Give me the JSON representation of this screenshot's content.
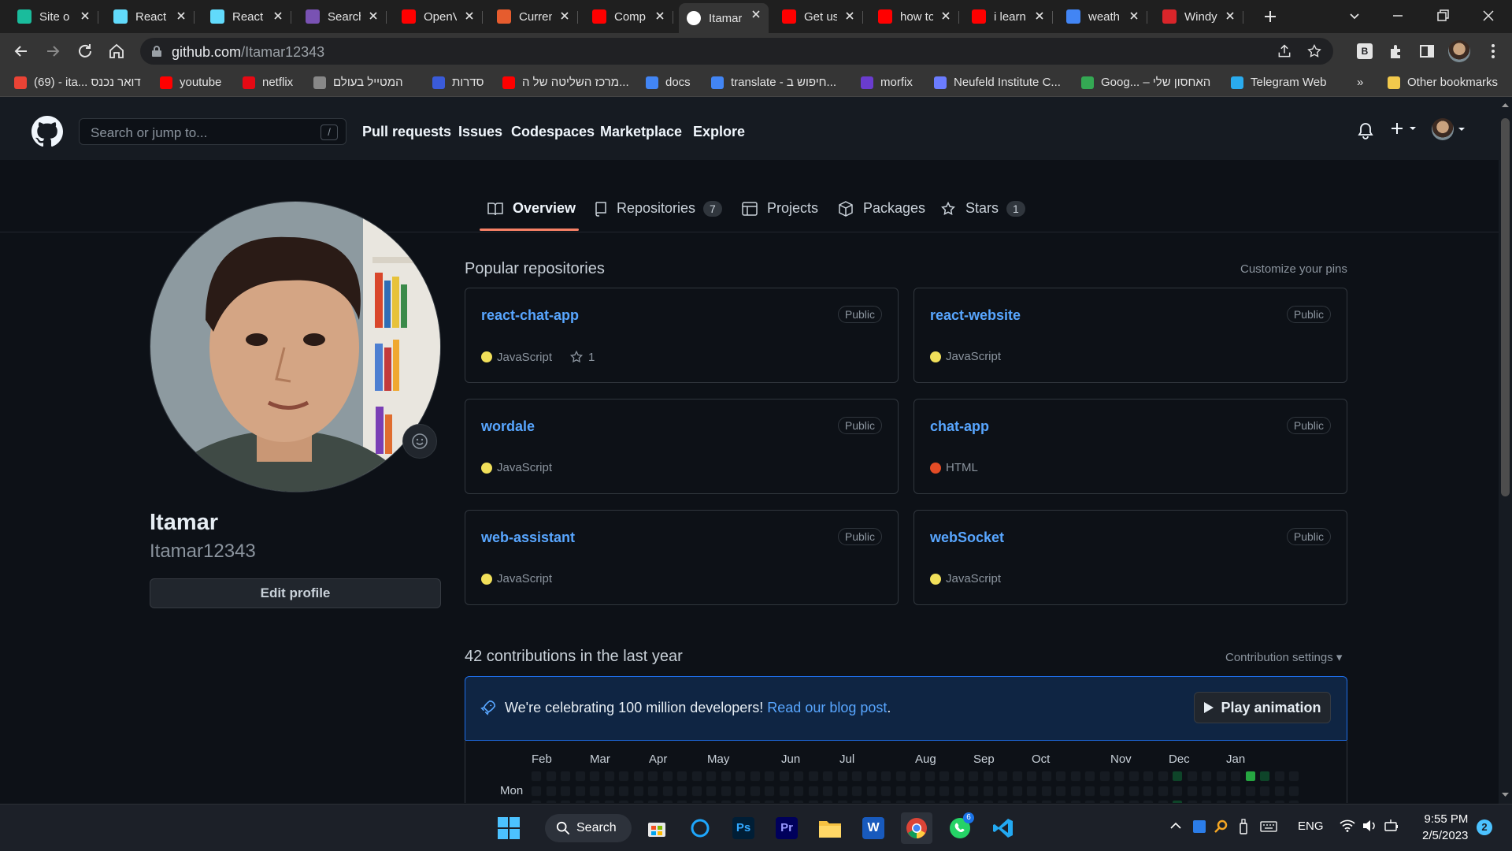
{
  "browser": {
    "tabs": [
      {
        "title": "Site o",
        "icon": "diamond-icon",
        "color": "#1abc9c"
      },
      {
        "title": "React",
        "icon": "react-icon",
        "color": "#61dafb"
      },
      {
        "title": "React",
        "icon": "react-icon",
        "color": "#61dafb"
      },
      {
        "title": "Search",
        "icon": "bootstrap-icon",
        "color": "#7952b3"
      },
      {
        "title": "OpenV",
        "icon": "youtube-icon",
        "color": "#ff0000"
      },
      {
        "title": "Curren",
        "icon": "curseforge-icon",
        "color": "#e65c2e"
      },
      {
        "title": "Comp",
        "icon": "youtube-icon",
        "color": "#ff0000"
      },
      {
        "title": "Itamar",
        "icon": "github-icon",
        "color": "#ffffff",
        "active": true
      },
      {
        "title": "Get us",
        "icon": "youtube-icon",
        "color": "#ff0000"
      },
      {
        "title": "how to",
        "icon": "youtube-icon",
        "color": "#ff0000"
      },
      {
        "title": "i learn",
        "icon": "youtube-icon",
        "color": "#ff0000"
      },
      {
        "title": "weath",
        "icon": "google-icon",
        "color": "#4285f4"
      },
      {
        "title": "Windy",
        "icon": "windy-icon",
        "color": "#d9252a"
      }
    ],
    "url_host": "github.com",
    "url_path": "/Itamar12343",
    "bookmarks": [
      {
        "label": "(69) - ita... דואר נכנס",
        "icon": "gmail-icon",
        "color": "#ea4335"
      },
      {
        "label": "youtube",
        "icon": "youtube-icon",
        "color": "#ff0000"
      },
      {
        "label": "netflix",
        "icon": "netflix-icon",
        "color": "#e50914"
      },
      {
        "label": "המטייל בעולם",
        "icon": "site-icon",
        "color": "#888888"
      },
      {
        "label": "סדרות",
        "icon": "site-icon",
        "color": "#3a5bd9"
      },
      {
        "label": "מרכז השליטה של ה...",
        "icon": "youtube-icon",
        "color": "#ff0000"
      },
      {
        "label": "docs",
        "icon": "docs-icon",
        "color": "#4285f4"
      },
      {
        "label": "translate - חיפוש ב...",
        "icon": "google-icon",
        "color": "#4285f4"
      },
      {
        "label": "morfix",
        "icon": "morfix-icon",
        "color": "#6a3ccf"
      },
      {
        "label": "Neufeld Institute C...",
        "icon": "site-icon",
        "color": "#6b7cff"
      },
      {
        "label": "Goog... – האחסון שלי",
        "icon": "drive-icon",
        "color": "#34a853"
      },
      {
        "label": "Telegram Web",
        "icon": "telegram-icon",
        "color": "#2aabee"
      }
    ],
    "more_bookmarks": "»",
    "other_bookmarks": "Other bookmarks"
  },
  "github": {
    "search_placeholder": "Search or jump to...",
    "search_key": "/",
    "nav": [
      "Pull requests",
      "Issues",
      "Codespaces",
      "Marketplace",
      "Explore"
    ],
    "profile_tabs": [
      {
        "label": "Overview",
        "count": null,
        "selected": true
      },
      {
        "label": "Repositories",
        "count": "7"
      },
      {
        "label": "Projects",
        "count": null
      },
      {
        "label": "Packages",
        "count": null
      },
      {
        "label": "Stars",
        "count": "1"
      }
    ],
    "profile": {
      "name": "Itamar",
      "login": "Itamar12343",
      "edit_label": "Edit profile"
    },
    "popular": {
      "heading": "Popular repositories",
      "customize": "Customize your pins",
      "repos": [
        {
          "name": "react-chat-app",
          "visibility": "Public",
          "language": "JavaScript",
          "lang_color": "#f1e05a",
          "stars": "1"
        },
        {
          "name": "react-website",
          "visibility": "Public",
          "language": "JavaScript",
          "lang_color": "#f1e05a"
        },
        {
          "name": "wordale",
          "visibility": "Public",
          "language": "JavaScript",
          "lang_color": "#f1e05a"
        },
        {
          "name": "chat-app",
          "visibility": "Public",
          "language": "HTML",
          "lang_color": "#e34c26"
        },
        {
          "name": "web-assistant",
          "visibility": "Public",
          "language": "JavaScript",
          "lang_color": "#f1e05a"
        },
        {
          "name": "webSocket",
          "visibility": "Public",
          "language": "JavaScript",
          "lang_color": "#f1e05a"
        }
      ]
    },
    "contributions": {
      "heading": "42 contributions in the last year",
      "settings": "Contribution settings ▾",
      "banner_text": "We're celebrating 100 million developers! ",
      "banner_link": "Read our blog post",
      "banner_end": ".",
      "play_label": "Play animation",
      "months": [
        "Feb",
        "Mar",
        "Apr",
        "May",
        "Jun",
        "Jul",
        "Aug",
        "Sep",
        "Oct",
        "Nov",
        "Dec",
        "Jan"
      ],
      "day_label": "Mon"
    }
  },
  "taskbar": {
    "search_label": "Search",
    "whatsapp_badge": "6",
    "language": "ENG",
    "time": "9:55 PM",
    "date": "2/5/2023",
    "notifications": "2"
  }
}
